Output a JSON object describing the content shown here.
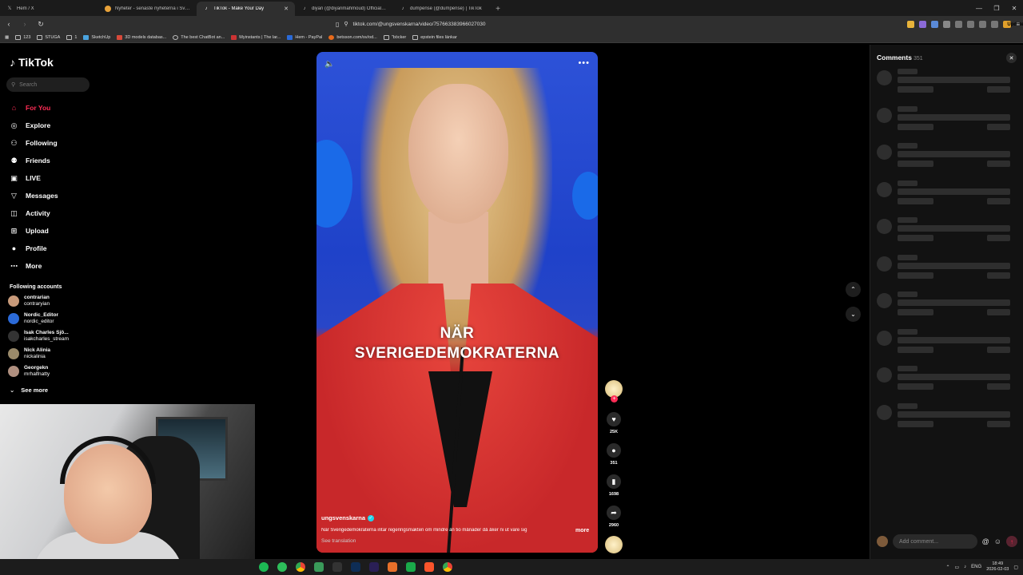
{
  "browser": {
    "tabs": [
      {
        "title": "Hem / X",
        "icon": "x-icon",
        "active": false
      },
      {
        "title": "Nyheter - senaste nyheterna i Sverig…",
        "icon": "news-icon",
        "active": false
      },
      {
        "title": "TikTok - Make Your Day",
        "icon": "tiktok-icon",
        "active": true
      },
      {
        "title": "diyari (@diyarimahmoud) Official | Ti…",
        "icon": "tiktok-icon",
        "active": false
      },
      {
        "title": "dumpense (@dumpense) | TikTok",
        "icon": "tiktok-icon",
        "active": false
      }
    ],
    "url": "tiktok.com/@ungsvenskarna/video/7576633839660270​30",
    "update_label": "Update",
    "bookmarks": [
      "123",
      "STUGA",
      "1",
      "SketchUp",
      "3D models databas...",
      "The best ChatBot an...",
      "Myinstants | The lar...",
      "Hem - PayPal",
      "betsson.com/sv/od...",
      "\"böcker",
      "epstein files länkar"
    ]
  },
  "sidebar": {
    "brand": "TikTok",
    "search_placeholder": "Search",
    "nav": [
      {
        "label": "For You",
        "icon": "home-icon",
        "glyph": "⌂",
        "active": true
      },
      {
        "label": "Explore",
        "icon": "compass-icon",
        "glyph": "◎",
        "active": false
      },
      {
        "label": "Following",
        "icon": "following-icon",
        "glyph": "⚇",
        "active": false
      },
      {
        "label": "Friends",
        "icon": "friends-icon",
        "glyph": "⚉",
        "active": false
      },
      {
        "label": "LIVE",
        "icon": "live-icon",
        "glyph": "▣",
        "active": false
      },
      {
        "label": "Messages",
        "icon": "messages-icon",
        "glyph": "▽",
        "active": false
      },
      {
        "label": "Activity",
        "icon": "activity-icon",
        "glyph": "◫",
        "active": false
      },
      {
        "label": "Upload",
        "icon": "upload-icon",
        "glyph": "⊞",
        "active": false
      },
      {
        "label": "Profile",
        "icon": "profile-icon",
        "glyph": "●",
        "active": false
      },
      {
        "label": "More",
        "icon": "more-icon",
        "glyph": "⋯",
        "active": false
      }
    ],
    "following_title": "Following accounts",
    "accounts": [
      {
        "name": "contrarian",
        "handle": "contraryian",
        "color": "#c89a7a"
      },
      {
        "name": "Nordic_Editor",
        "handle": "nordic_editor",
        "color": "#2b6ad8"
      },
      {
        "name": "Isak Charles Sjö...",
        "handle": "isakcharles_stream",
        "color": "#333333"
      },
      {
        "name": "Nick Alinia",
        "handle": "nickalinia",
        "color": "#9a8a6a"
      },
      {
        "name": "Georgekn",
        "handle": "mrhalfnatty",
        "color": "#b09080"
      }
    ],
    "see_more": "See more"
  },
  "video": {
    "caption_line1": "NÄR",
    "caption_line2": "SVERIGEDEMOKRATERNA",
    "username": "ungsvenskarna",
    "description": "När Sverigedemokraterna intar regeringsmakten om mindre än tio månader då åker ni ut vare sig",
    "more_label": "more",
    "translation_label": "See translation"
  },
  "actions": {
    "likes": "25K",
    "comments": "351",
    "saves": "1698",
    "shares": "2960"
  },
  "comments_panel": {
    "title": "Comments",
    "count": "351",
    "placeholder": "Add comment...",
    "skeleton_rows": 10
  },
  "taskbar": {
    "language": "ENG",
    "time": "18:49",
    "date": "2026-02-03"
  }
}
